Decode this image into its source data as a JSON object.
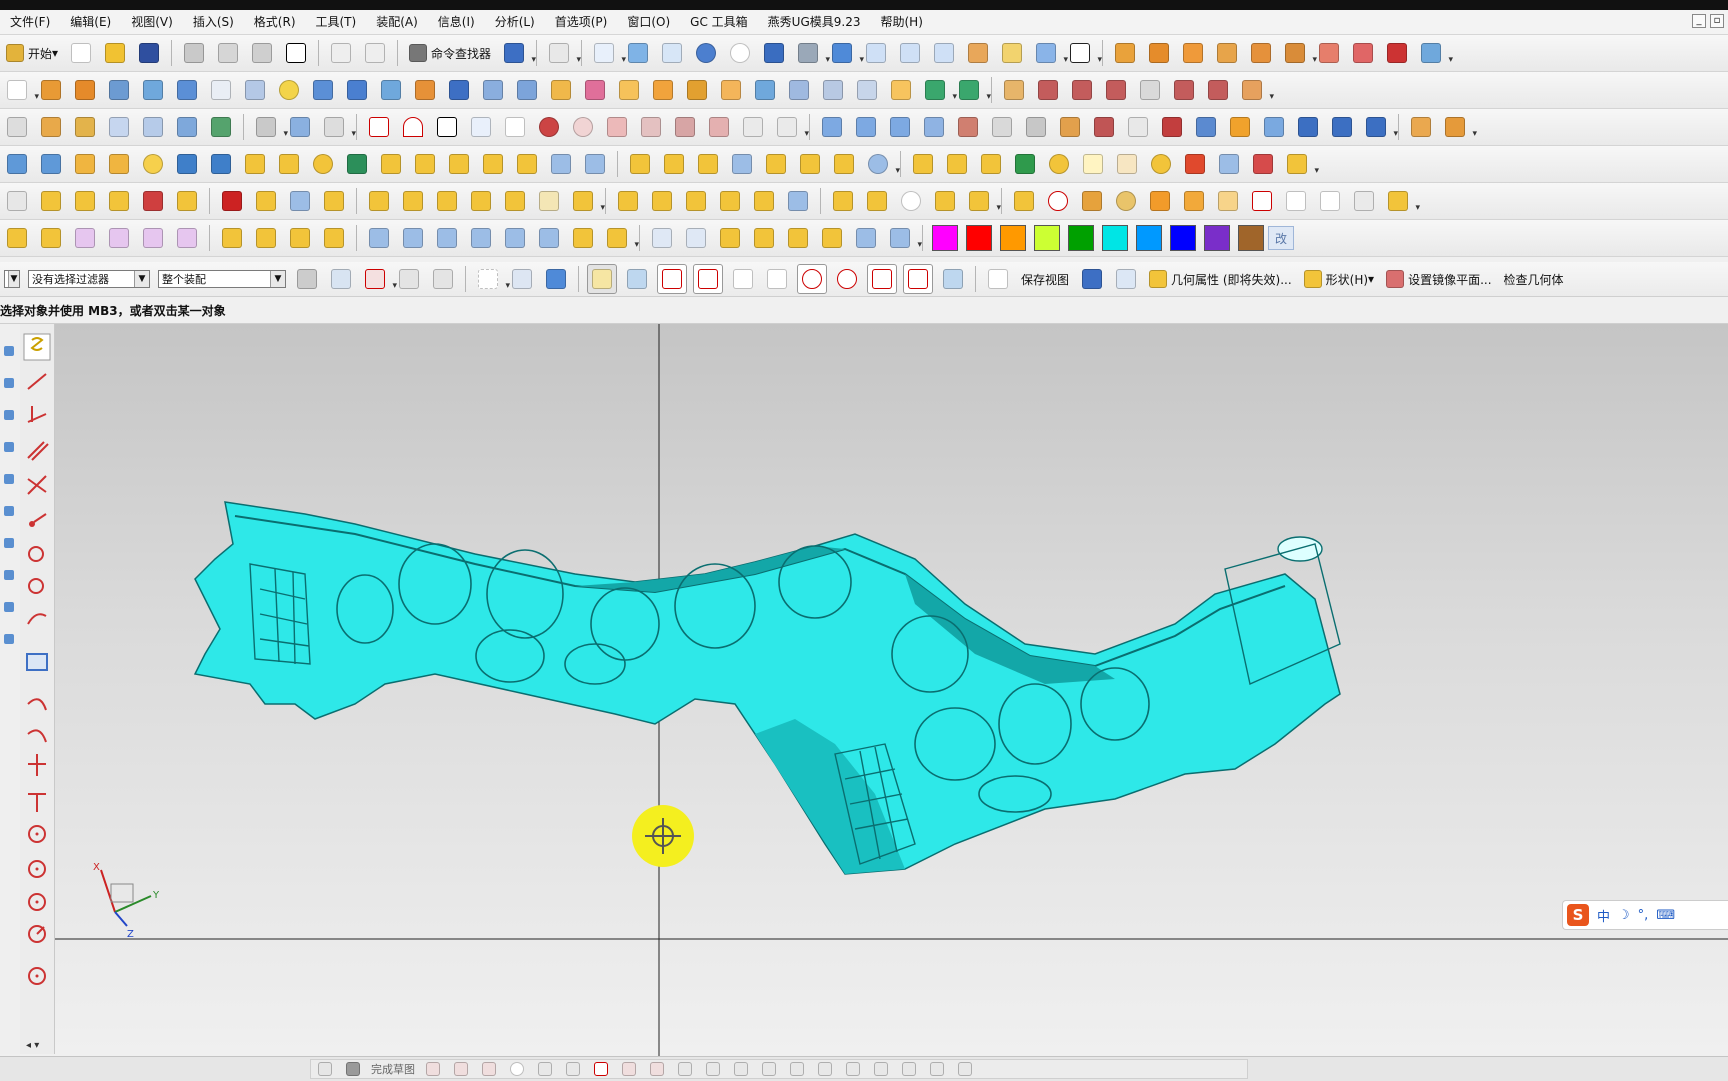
{
  "menubar": {
    "items": [
      "文件(F)",
      "编辑(E)",
      "视图(V)",
      "插入(S)",
      "格式(R)",
      "工具(T)",
      "装配(A)",
      "信息(I)",
      "分析(L)",
      "首选项(P)",
      "窗口(O)",
      "GC 工具箱",
      "燕秀UG模具9.23",
      "帮助(H)"
    ]
  },
  "window_controls": {
    "minimize": "_",
    "restore": "▫"
  },
  "toolbar1": {
    "start_label": "开始",
    "command_finder_label": "命令查找器"
  },
  "toolbar6": {
    "swatch_colors": [
      "#ff00ff",
      "#ff0000",
      "#ff9900",
      "#ccff33",
      "#00a000",
      "#00e5e5",
      "#0099ff",
      "#0000ff",
      "#7a2ec9",
      "#a0652a"
    ],
    "edit_label": "改"
  },
  "selection_bar": {
    "filter_value": "没有选择过滤器",
    "scope_value": "整个装配",
    "save_view_label": "保存视图",
    "geometry_props_label": "几何属性 (即将失效)...",
    "shape_label": "形状(H)",
    "mirror_plane_label": "设置镜像平面...",
    "check_geometry_label": "检查几何体"
  },
  "status": {
    "cue_text": "选择对象并使用 MB3，或者双击某一对象"
  },
  "bottom_sketch": {
    "finish_sketch_label": "完成草图"
  },
  "triad": {
    "x": "X",
    "y": "Y",
    "z": "Z"
  },
  "ime": {
    "lang": "中",
    "moon": "☽",
    "punct": "°,",
    "kbd": "⌨"
  },
  "colors": {
    "model_fill": "#2ee8e8",
    "model_shade": "#13a7a8",
    "cursor_yellow": "#f4ef1f"
  }
}
